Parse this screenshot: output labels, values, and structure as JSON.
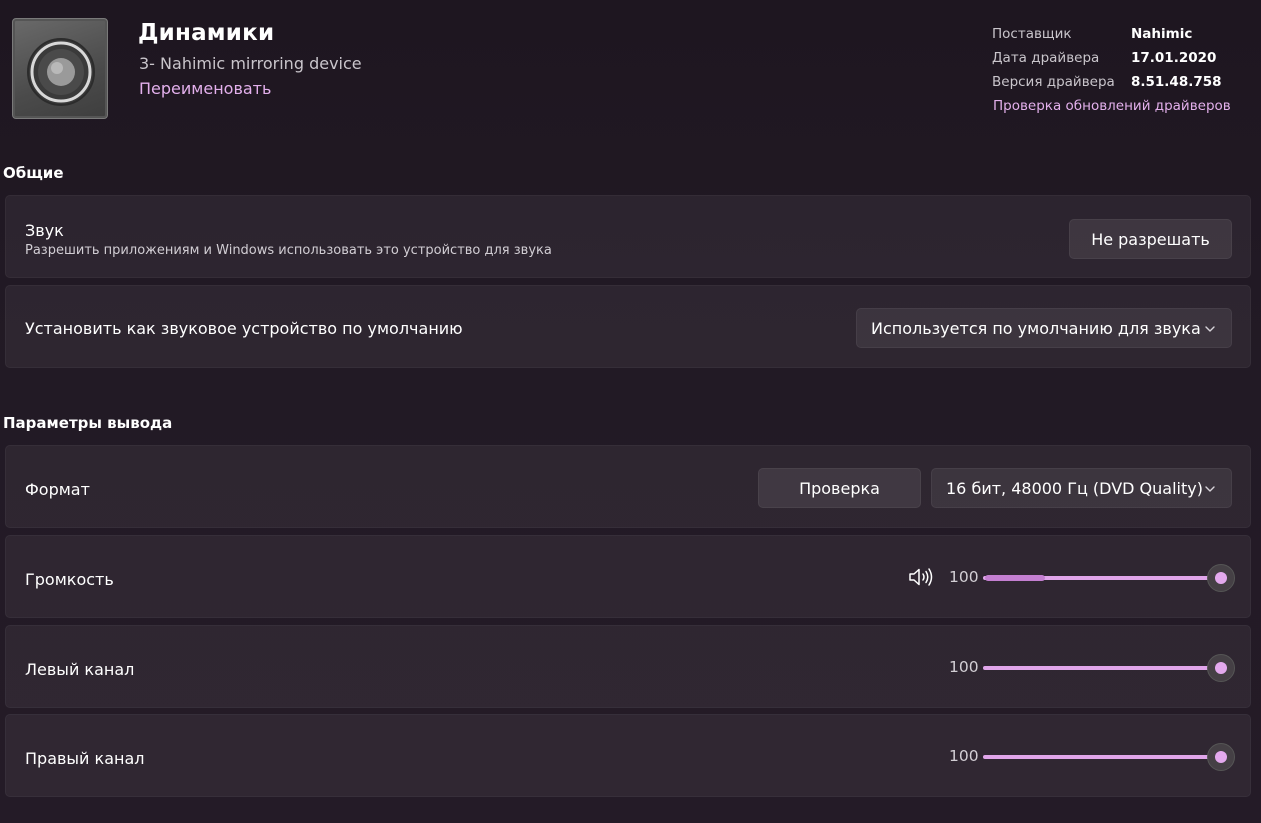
{
  "header": {
    "title": "Динамики",
    "subtitle": "3- Nahimic mirroring device",
    "rename_link": "Переименовать"
  },
  "driver_info": {
    "provider_label": "Поставщик",
    "provider_value": "Nahimic",
    "date_label": "Дата драйвера",
    "date_value": "17.01.2020",
    "version_label": "Версия драйвера",
    "version_value": "8.51.48.758",
    "update_link": "Проверка обновлений драйверов"
  },
  "general": {
    "section_title": "Общие",
    "sound": {
      "title": "Звук",
      "description": "Разрешить приложениям и Windows использовать это устройство для звука",
      "button_label": "Не разрешать"
    },
    "default_device": {
      "title": "Установить как звуковое устройство по умолчанию",
      "selected_option": "Используется по умолчанию для звука"
    }
  },
  "output": {
    "section_title": "Параметры вывода",
    "format": {
      "title": "Формат",
      "test_button_label": "Проверка",
      "selected_option": "16 бит, 48000 Гц (DVD Quality)"
    },
    "volume": {
      "title": "Громкость",
      "value": "100",
      "level": 100
    },
    "left_channel": {
      "title": "Левый канал",
      "value": "100",
      "level": 100
    },
    "right_channel": {
      "title": "Правый канал",
      "value": "100",
      "level": 100
    }
  },
  "icons": {
    "device": "speaker-device-icon",
    "chevron": "chevron-down-icon",
    "volume": "speaker-volume-icon"
  },
  "colors": {
    "accent": "#e0a5ea",
    "link": "#e3b0ec",
    "background": "#221a25"
  }
}
